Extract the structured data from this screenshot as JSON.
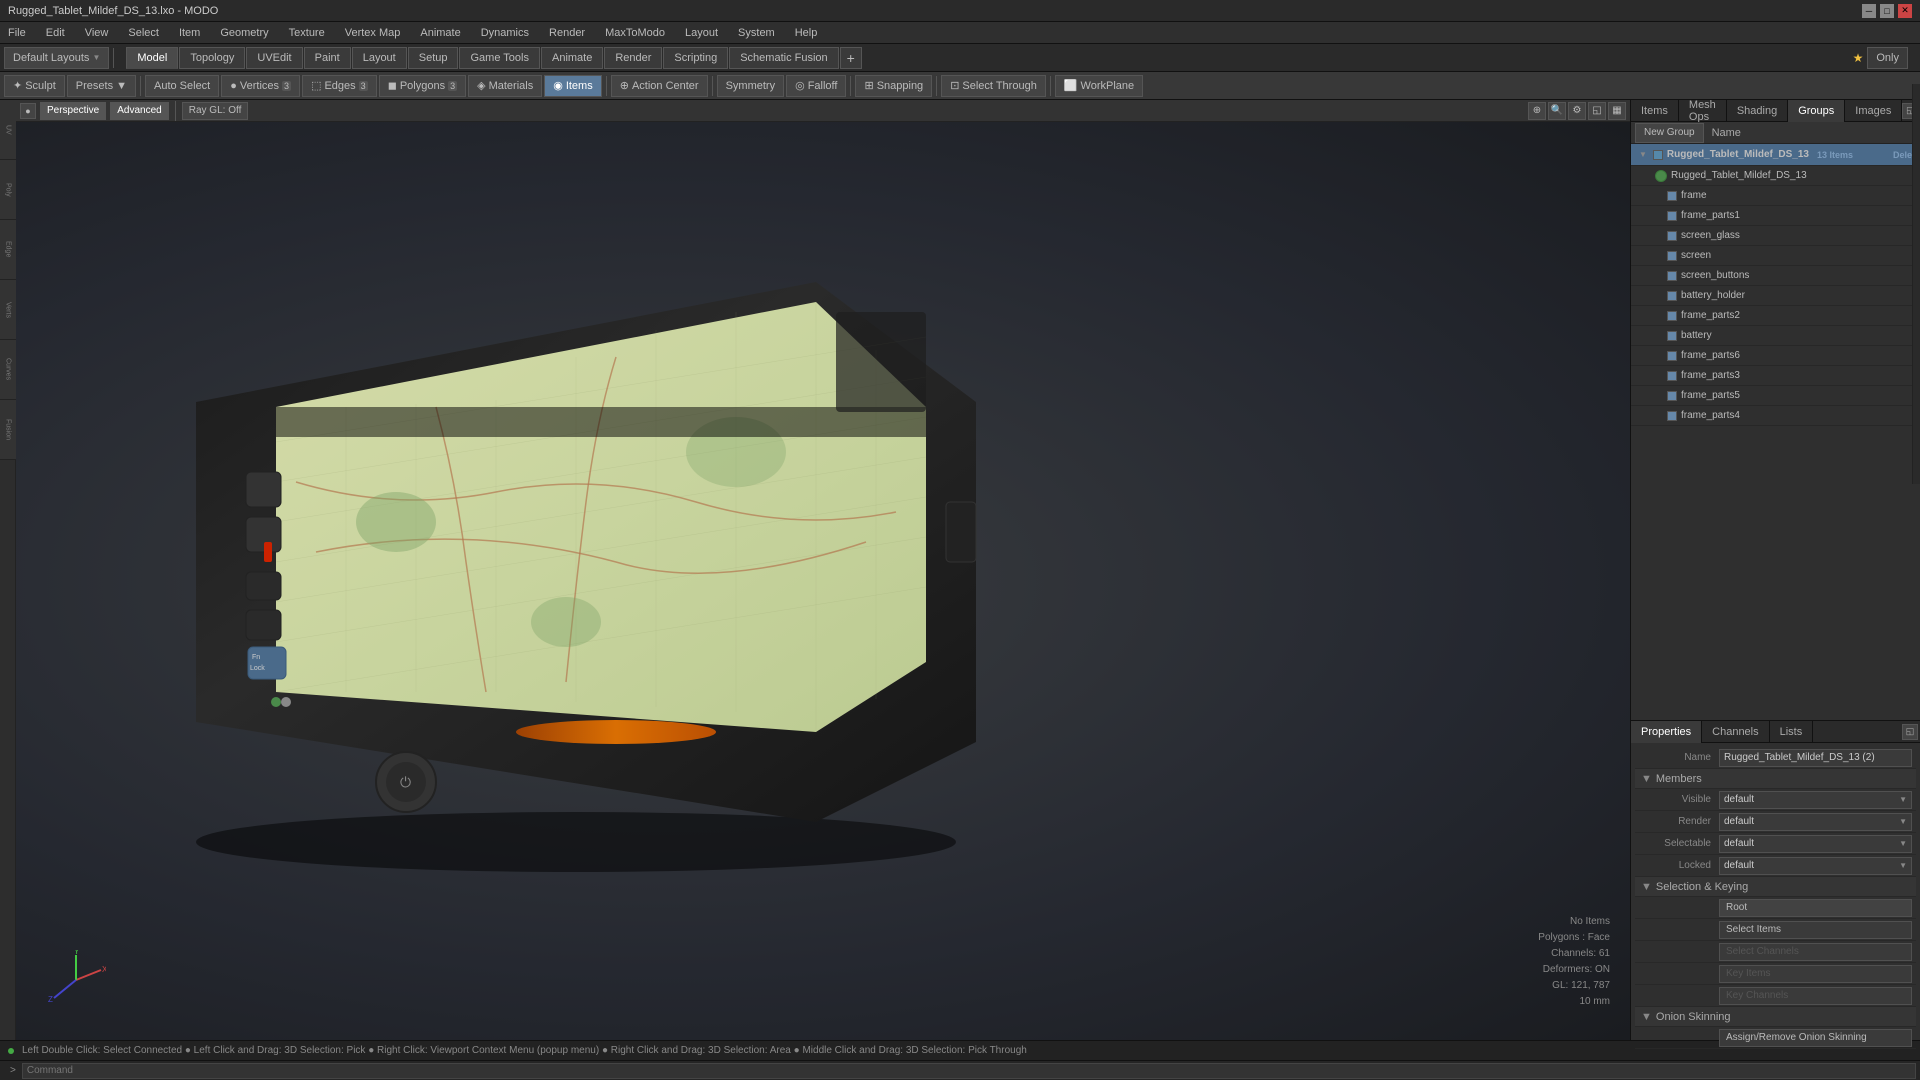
{
  "titlebar": {
    "title": "Rugged_Tablet_Mildef_DS_13.lxo - MODO"
  },
  "menubar": {
    "items": [
      "File",
      "Edit",
      "View",
      "Select",
      "Item",
      "Geometry",
      "Texture",
      "Vertex Map",
      "Animate",
      "Dynamics",
      "Render",
      "MaxToModo",
      "Layout",
      "System",
      "Help"
    ]
  },
  "toolbar_top": {
    "left_btn": "Default Layouts",
    "tabs": [
      "Model",
      "Topology",
      "UVEdit",
      "Paint",
      "Layout",
      "Setup",
      "Game Tools",
      "Animate",
      "Render",
      "Scripting",
      "Schematic Fusion"
    ],
    "active_tab": "Model",
    "only_btn": "Only",
    "plus_btn": "+"
  },
  "mode_toolbar": {
    "sculpt_btn": "Sculpt",
    "presets_btn": "Presets",
    "auto_select": "Auto Select",
    "vertices_btn": "Vertices",
    "edges_btn": "Edges",
    "polygons_btn": "Polygons",
    "materials_btn": "Materials",
    "items_btn": "Items",
    "action_center_btn": "Action Center",
    "symmetry_btn": "Symmetry",
    "falloff_btn": "Falloff",
    "snapping_btn": "Snapping",
    "select_through_btn": "Select Through",
    "workplane_btn": "WorkPlane"
  },
  "viewport": {
    "perspective_btn": "Perspective",
    "advanced_btn": "Advanced",
    "ray_gl_btn": "Ray GL: Off"
  },
  "scene_info": {
    "no_items": "No Items",
    "polygons": "Polygons : Face",
    "channels": "Channels: 61",
    "deformers": "Deformers: ON",
    "gl_info": "GL: 121, 787",
    "scale_info": "10 mm"
  },
  "right_panel": {
    "tabs": [
      "Items",
      "Mesh Ops",
      "Shading",
      "Groups",
      "Images"
    ],
    "active_tab": "Groups",
    "new_group_btn": "New Group",
    "name_col": "Name",
    "scene_tree": {
      "group_name": "Rugged_Tablet_Mildef_DS_13",
      "item_count": "13 Items",
      "items": [
        {
          "name": "Rugged_Tablet_Mildef_DS_13",
          "indent": 1,
          "selected": true
        },
        {
          "name": "frame",
          "indent": 2
        },
        {
          "name": "frame_parts1",
          "indent": 2
        },
        {
          "name": "screen_glass",
          "indent": 2
        },
        {
          "name": "screen",
          "indent": 2
        },
        {
          "name": "screen_buttons",
          "indent": 2
        },
        {
          "name": "battery_holder",
          "indent": 2
        },
        {
          "name": "frame_parts2",
          "indent": 2
        },
        {
          "name": "battery",
          "indent": 2
        },
        {
          "name": "frame_parts6",
          "indent": 2
        },
        {
          "name": "frame_parts3",
          "indent": 2
        },
        {
          "name": "frame_parts5",
          "indent": 2
        },
        {
          "name": "frame_parts4",
          "indent": 2
        }
      ]
    }
  },
  "properties": {
    "tabs": [
      "Properties",
      "Channels",
      "Lists"
    ],
    "active_tab": "Properties",
    "name_value": "Rugged_Tablet_Mildef_DS_13 (2)",
    "members_section": "Members",
    "visible_label": "Visible",
    "visible_value": "default",
    "render_label": "Render",
    "render_value": "default",
    "selectable_label": "Selectable",
    "selectable_value": "default",
    "locked_label": "Locked",
    "locked_value": "default",
    "selection_keying_section": "Selection & Keying",
    "root_btn": "Root",
    "select_items_btn": "Select Items",
    "select_channels_btn": "Select Channels",
    "key_items_btn": "Key Items",
    "key_channels_btn": "Key Channels",
    "onion_skinning_section": "Onion Skinning",
    "assign_remove_btn": "Assign/Remove Onion Skinning"
  },
  "statusbar": {
    "text": "Left Double Click: Select Connected ● Left Click and Drag: 3D Selection: Pick ● Right Click: Viewport Context Menu (popup menu) ● Right Click and Drag: 3D Selection: Area ● Middle Click and Drag: 3D Selection: Pick Through"
  },
  "cmdbar": {
    "label": ">",
    "placeholder": "Command"
  },
  "left_sidebar": {
    "items": [
      "UV",
      "Poly",
      "Edge",
      "Verts",
      "Curves",
      "Fusion"
    ]
  }
}
